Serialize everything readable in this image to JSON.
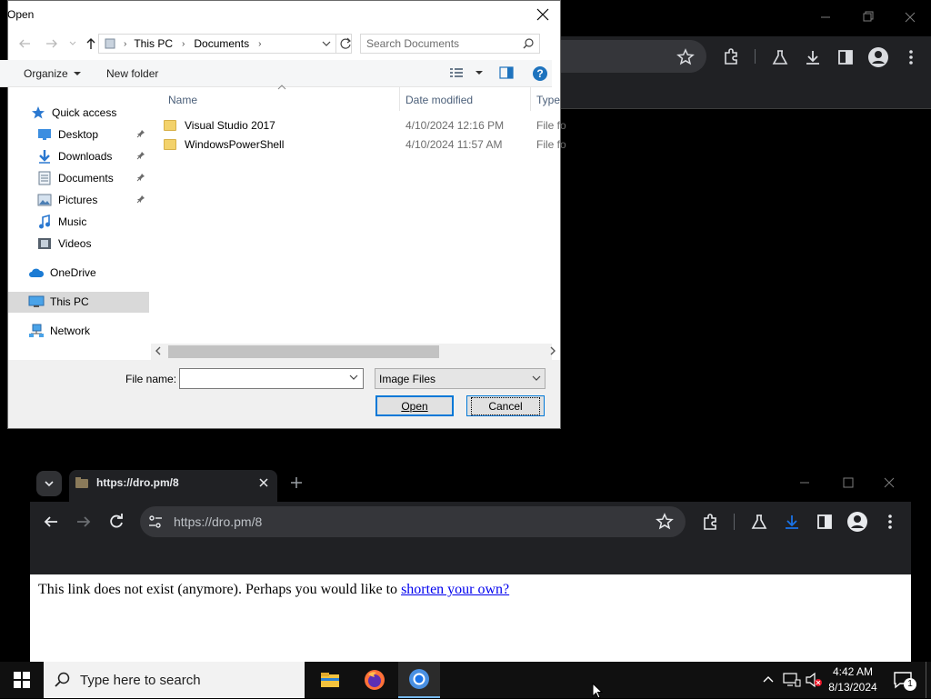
{
  "dialog": {
    "title": "Open",
    "path": [
      "This PC",
      "Documents"
    ],
    "search_placeholder": "Search Documents",
    "toolbar": {
      "organize": "Organize",
      "new_folder": "New folder"
    },
    "nav": [
      {
        "label": "Quick access",
        "icon": "star-icon"
      },
      {
        "label": "Desktop",
        "icon": "desktop-icon",
        "pinned": true
      },
      {
        "label": "Downloads",
        "icon": "download-arrow-icon",
        "pinned": true
      },
      {
        "label": "Documents",
        "icon": "documents-icon",
        "pinned": true
      },
      {
        "label": "Pictures",
        "icon": "pictures-icon",
        "pinned": true
      },
      {
        "label": "Music",
        "icon": "music-icon"
      },
      {
        "label": "Videos",
        "icon": "videos-icon"
      },
      {
        "label": "OneDrive",
        "icon": "cloud-icon"
      },
      {
        "label": "This PC",
        "icon": "computer-icon",
        "selected": true
      },
      {
        "label": "Network",
        "icon": "network-icon"
      }
    ],
    "columns": {
      "name": "Name",
      "date": "Date modified",
      "type": "Type"
    },
    "files": [
      {
        "name": "Visual Studio 2017",
        "date": "4/10/2024 12:16 PM",
        "type": "File fo"
      },
      {
        "name": "WindowsPowerShell",
        "date": "4/10/2024 11:57 AM",
        "type": "File fo"
      }
    ],
    "file_name_label": "File name:",
    "file_name_value": "",
    "file_type": "Image Files",
    "open_label": "Open",
    "cancel_label": "Cancel"
  },
  "browser": {
    "tab_title": "https://dro.pm/8",
    "url": "https://dro.pm/8",
    "page_text": "This link does not exist (anymore). Perhaps you would like to",
    "page_link": "shorten your own?"
  },
  "taskbar": {
    "search_placeholder": "Type here to search",
    "time": "4:42 AM",
    "date": "8/13/2024",
    "notification_count": "1"
  },
  "colors": {
    "accent": "#0078d7",
    "chrome_dark": "#202124",
    "link": "#0000ee"
  }
}
